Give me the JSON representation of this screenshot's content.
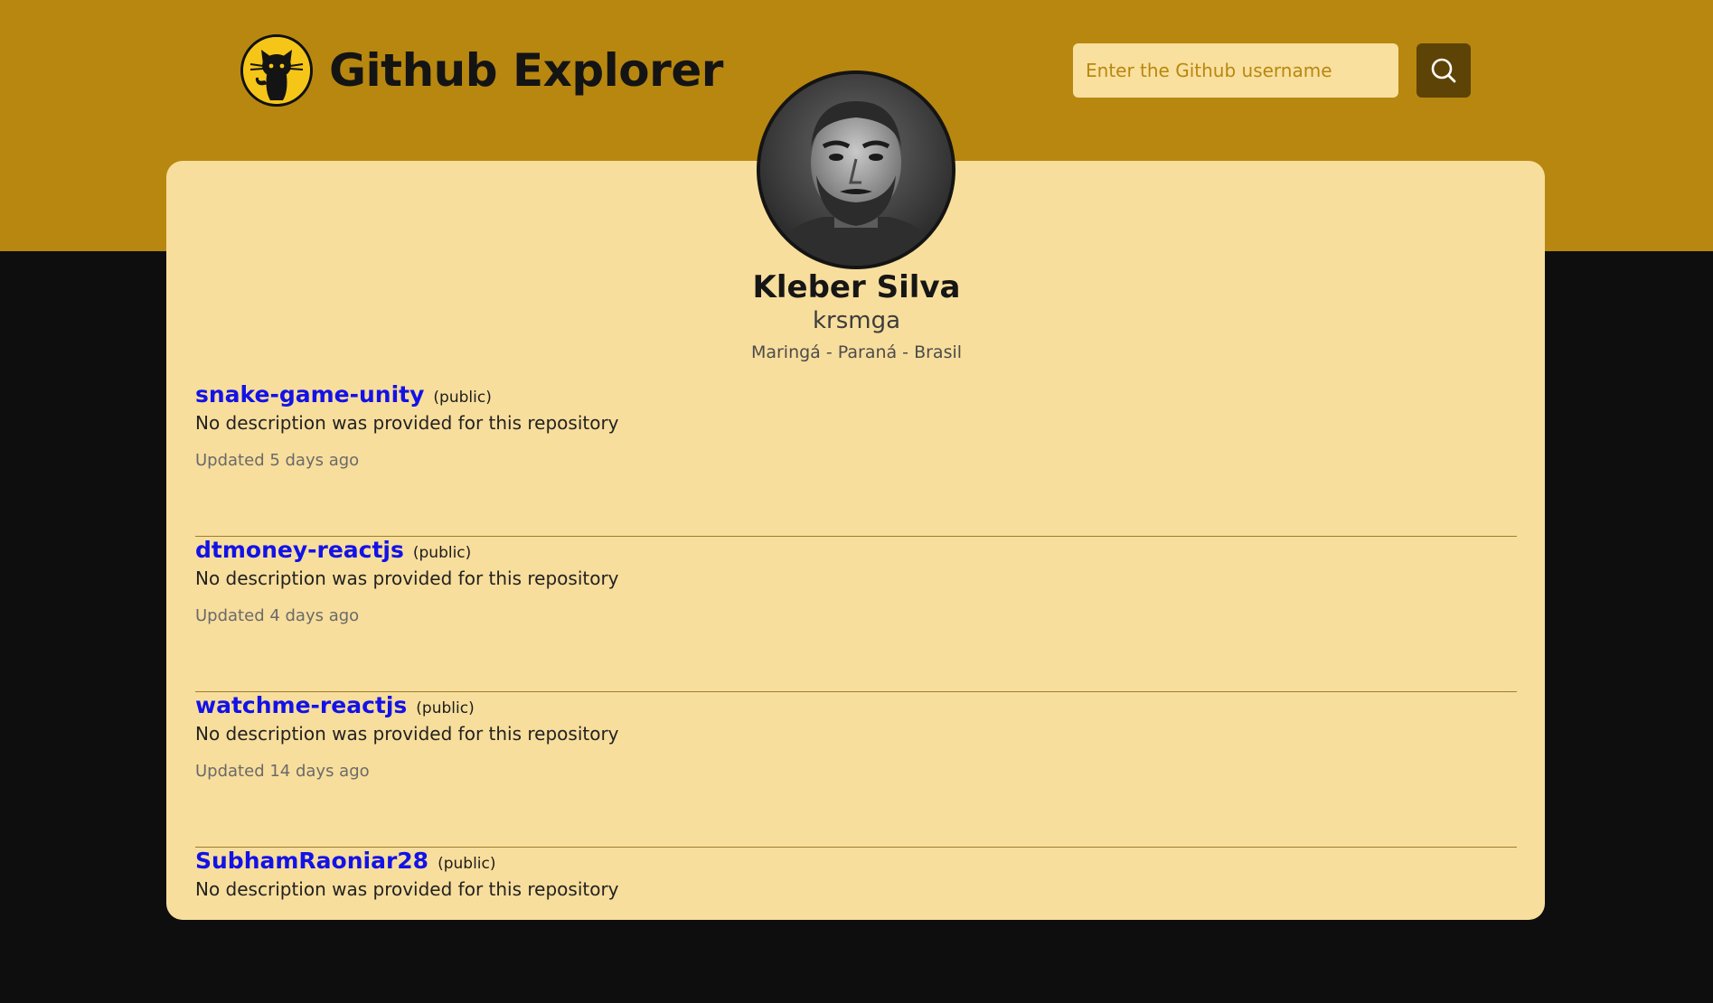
{
  "header": {
    "title": "Github Explorer",
    "logo_icon": "github-octocat-icon",
    "brand_color": "#b8870f",
    "logo_color": "#f5c518"
  },
  "search": {
    "value": "",
    "placeholder": "Enter the Github username",
    "button_icon": "search-icon",
    "button_color": "#5e4306"
  },
  "profile": {
    "name": "Kleber Silva",
    "login": "krsmga",
    "location": "Maringá - Paraná - Brasil",
    "avatar_icon": "user-avatar"
  },
  "repos": [
    {
      "name": "snake-game-unity",
      "visibility": "(public)",
      "description": "No description was provided for this repository",
      "updated": "Updated 5 days ago"
    },
    {
      "name": "dtmoney-reactjs",
      "visibility": "(public)",
      "description": "No description was provided for this repository",
      "updated": "Updated 4 days ago"
    },
    {
      "name": "watchme-reactjs",
      "visibility": "(public)",
      "description": "No description was provided for this repository",
      "updated": "Updated 14 days ago"
    },
    {
      "name": "SubhamRaoniar28",
      "visibility": "(public)",
      "description": "No description was provided for this repository",
      "updated": ""
    }
  ],
  "colors": {
    "card": "#f8de9c",
    "page_background": "#0e0e0e",
    "repo_link": "#1212e8"
  }
}
